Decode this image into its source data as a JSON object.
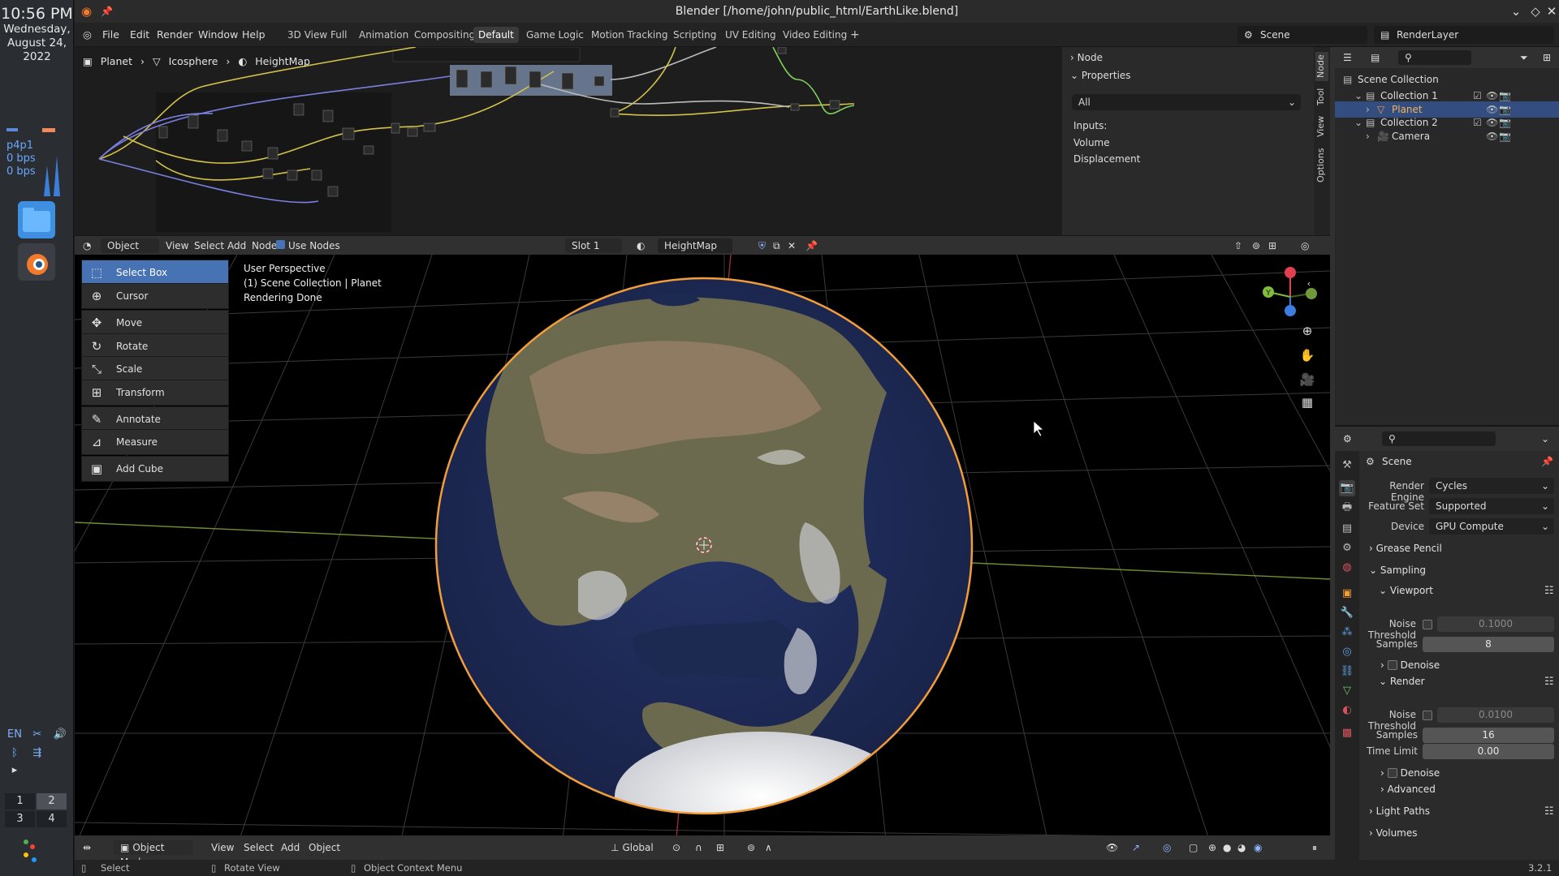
{
  "desktop": {
    "time": "10:56 PM",
    "date_line1": "Wednesday,",
    "date_line2": "August 24,",
    "date_line3": "2022",
    "net_iface": "p4p1",
    "net_rx": "0 bps",
    "net_tx": "0 bps",
    "tray": {
      "lang": "EN"
    },
    "workspaces": [
      "1",
      "2",
      "3",
      "4"
    ],
    "active_workspace": "2"
  },
  "window": {
    "title": "Blender [/home/john/public_html/EarthLike.blend]",
    "menus": [
      "File",
      "Edit",
      "Render",
      "Window",
      "Help"
    ],
    "workspace_tabs": [
      "3D View Full",
      "Animation",
      "Compositing",
      "Default",
      "Game Logic",
      "Motion Tracking",
      "Scripting",
      "UV Editing",
      "Video Editing"
    ],
    "active_tab": "Default",
    "add_tab": "+",
    "scene": "Scene",
    "view_layer": "RenderLayer"
  },
  "node_editor": {
    "breadcrumb": [
      "Planet",
      "Icosphere",
      "HeightMap"
    ],
    "panel": {
      "node_label": "Node",
      "properties_label": "Properties",
      "filter_value": "All",
      "rows": [
        "Inputs:",
        "Volume",
        "Displacement"
      ]
    },
    "side_tabs": [
      "Node",
      "Tool",
      "View",
      "Options"
    ],
    "header": {
      "mode": "Object",
      "menus": [
        "View",
        "Select",
        "Add",
        "Node"
      ],
      "use_nodes": "Use Nodes",
      "slot": "Slot 1",
      "material": "HeightMap"
    }
  },
  "viewport": {
    "overlay": [
      "User Perspective",
      "(1) Scene Collection | Planet",
      "Rendering Done"
    ],
    "tools": [
      {
        "label": "Select Box",
        "icon": "select-box-icon",
        "glyph": "⬚",
        "active": true
      },
      {
        "label": "Cursor",
        "icon": "cursor-icon",
        "glyph": "⊕",
        "active": false
      },
      {
        "label": "Move",
        "icon": "move-icon",
        "glyph": "✥",
        "active": false
      },
      {
        "label": "Rotate",
        "icon": "rotate-icon",
        "glyph": "↻",
        "active": false
      },
      {
        "label": "Scale",
        "icon": "scale-icon",
        "glyph": "⤡",
        "active": false
      },
      {
        "label": "Transform",
        "icon": "transform-icon",
        "glyph": "⊞",
        "active": false
      },
      {
        "label": "Annotate",
        "icon": "annotate-icon",
        "glyph": "✎",
        "active": false
      },
      {
        "label": "Measure",
        "icon": "measure-icon",
        "glyph": "⊿",
        "active": false
      },
      {
        "label": "Add Cube",
        "icon": "add-cube-icon",
        "glyph": "▣",
        "active": false
      }
    ],
    "gizmo": {
      "x_color": "#e0404f",
      "y_color": "#7fbd3b",
      "z_color": "#3d7de0",
      "y_label": "Y"
    },
    "header": {
      "mode": "Object Mode",
      "menus": [
        "View",
        "Select",
        "Add",
        "Object"
      ],
      "orientation": "Global"
    }
  },
  "statusbar": {
    "left": "Select",
    "middle": "Rotate View",
    "right": "Object Context Menu",
    "version": "3.2.1"
  },
  "outliner": {
    "root": "Scene Collection",
    "items": [
      {
        "label": "Collection 1",
        "indent": 1,
        "selected": false,
        "icon": "collection-icon"
      },
      {
        "label": "Planet",
        "indent": 2,
        "selected": true,
        "icon": "mesh-object-icon"
      },
      {
        "label": "Collection 2",
        "indent": 1,
        "selected": false,
        "icon": "collection-icon"
      },
      {
        "label": "Camera",
        "indent": 2,
        "selected": false,
        "icon": "camera-object-icon"
      }
    ]
  },
  "properties": {
    "context": "Scene",
    "render_engine_label": "Render Engine",
    "render_engine": "Cycles",
    "feature_set_label": "Feature Set",
    "feature_set": "Supported",
    "device_label": "Device",
    "device": "GPU Compute",
    "sections": {
      "grease_pencil": "Grease Pencil",
      "sampling": "Sampling",
      "viewport": "Viewport",
      "render": "Render",
      "denoise": "Denoise",
      "advanced": "Advanced",
      "light_paths": "Light Paths",
      "volumes": "Volumes"
    },
    "viewport_noise_label": "Noise Threshold",
    "viewport_noise": "0.1000",
    "viewport_samples_label": "Samples",
    "viewport_samples": "8",
    "render_noise_label": "Noise Threshold",
    "render_noise": "0.0100",
    "render_samples_label": "Samples",
    "render_samples": "16",
    "time_limit_label": "Time Limit",
    "time_limit": "0.00"
  },
  "colors": {
    "accent": "#4772b3",
    "selection": "#334d80",
    "planet_outline": "#f29d38",
    "ocean": "#1c2a52",
    "land": "#6f6b4e"
  }
}
